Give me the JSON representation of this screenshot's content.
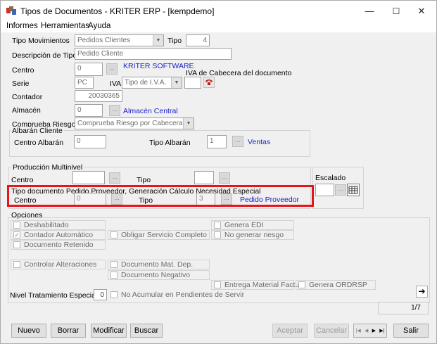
{
  "window": {
    "title": "Tipos de Documentos - KRITER ERP - [kempdemo]",
    "min": "—",
    "max": "☐",
    "close": "✕"
  },
  "menu": [
    "Informes",
    "Herramientas",
    "Ayuda"
  ],
  "form": {
    "tipo_movimientos": {
      "label": "Tipo Movimientos",
      "value": "Pedidos Clientes"
    },
    "tipo": {
      "label": "Tipo",
      "value": "4"
    },
    "descripcion": {
      "label": "Descripción de Tipo",
      "value": "Pedido Cliente"
    },
    "centro": {
      "label": "Centro",
      "value": "0",
      "link": "KRITER SOFTWARE"
    },
    "iva_cabecera_label": "IVA de Cabecera del documento",
    "serie": {
      "label": "Serie",
      "value": "PC",
      "iva_label": "IVA:",
      "iva_value": "Tipo de I.V.A."
    },
    "contador": {
      "label": "Contador",
      "value": "20030365"
    },
    "almacen": {
      "label": "Almacén",
      "value": "0",
      "link": "Almacén Central"
    },
    "comprueba": {
      "label": "Comprueba Riesgo",
      "value": "Comprueba Riesgo por Cabecera."
    }
  },
  "albaran": {
    "title": "Albarán Cliente",
    "centro_label": "Centro Albarán",
    "centro_value": "0",
    "tipo_label": "Tipo Albarán",
    "tipo_value": "1",
    "link": "Ventas"
  },
  "produccion": {
    "title": "Producción Multinivel",
    "centro_label": "Centro",
    "tipo_label": "Tipo"
  },
  "escalado": {
    "label": "Escalado"
  },
  "pedido_prov": {
    "title": "Tipo documento Pedido Proveedor, Generación Cálculo Necesidad Especial",
    "centro_label": "Centro",
    "centro_value": "0",
    "tipo_label": "Tipo",
    "tipo_value": "3",
    "link": "Pedido Proveedor"
  },
  "opciones": {
    "title": "Opciones",
    "deshabilitado": "Deshabilitado",
    "contador_auto": "Contador Automático",
    "documento_retenido": "Documento Retenido",
    "obligar": "Obligar Servicio Completo",
    "genera_edi": "Genera EDI",
    "no_generar_riesgo": "No generar riesgo",
    "controlar": "Controlar Alteraciones",
    "doc_mat_dep": "Documento Mat. Dep.",
    "doc_negativo": "Documento Negativo",
    "entrega_material": "Entrega Material Factur.",
    "genera_ordrsp": "Genera ORDRSP",
    "nivel_label": "Nivel Tratamiento Especial",
    "nivel_value": "0",
    "no_acumular": "No Acumular en Pendientes de Servir"
  },
  "paging": {
    "counter": "1/7",
    "next": "➔"
  },
  "buttons": {
    "nuevo": "Nuevo",
    "borrar": "Borrar",
    "modificar": "Modificar",
    "buscar": "Buscar",
    "aceptar": "Aceptar",
    "cancelar": "Cancelar",
    "salir": "Salir"
  },
  "nav": {
    "first": "|◀",
    "prev": "◀",
    "next": "▶",
    "last": "▶|"
  }
}
